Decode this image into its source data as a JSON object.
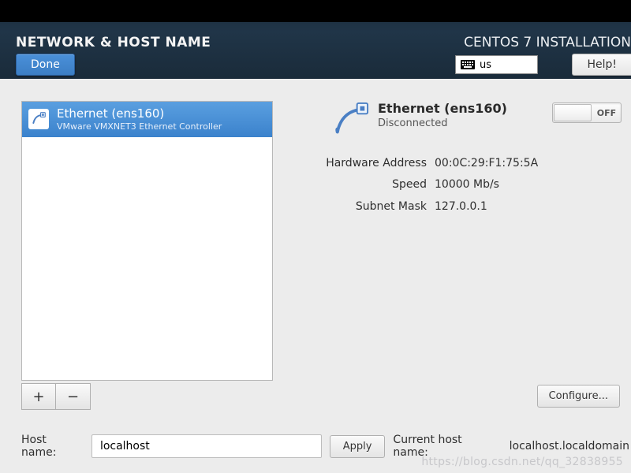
{
  "header": {
    "title": "NETWORK & HOST NAME",
    "installer": "CENTOS 7 INSTALLATION",
    "done": "Done",
    "help": "Help!",
    "keyboard_layout": "us"
  },
  "devices": {
    "items": [
      {
        "name": "Ethernet (ens160)",
        "subtitle": "VMware VMXNET3 Ethernet Controller"
      }
    ],
    "add_label": "+",
    "remove_label": "−"
  },
  "detail": {
    "name": "Ethernet (ens160)",
    "status": "Disconnected",
    "toggle_state": "OFF",
    "specs": [
      {
        "label": "Hardware Address",
        "value": "00:0C:29:F1:75:5A"
      },
      {
        "label": "Speed",
        "value": "10000 Mb/s"
      },
      {
        "label": "Subnet Mask",
        "value": "127.0.0.1"
      }
    ],
    "configure": "Configure..."
  },
  "hostname": {
    "label": "Host name:",
    "value": "localhost",
    "apply": "Apply",
    "current_label": "Current host name:",
    "current_value": "localhost.localdomain"
  },
  "watermark": "https://blog.csdn.net/qq_32838955"
}
